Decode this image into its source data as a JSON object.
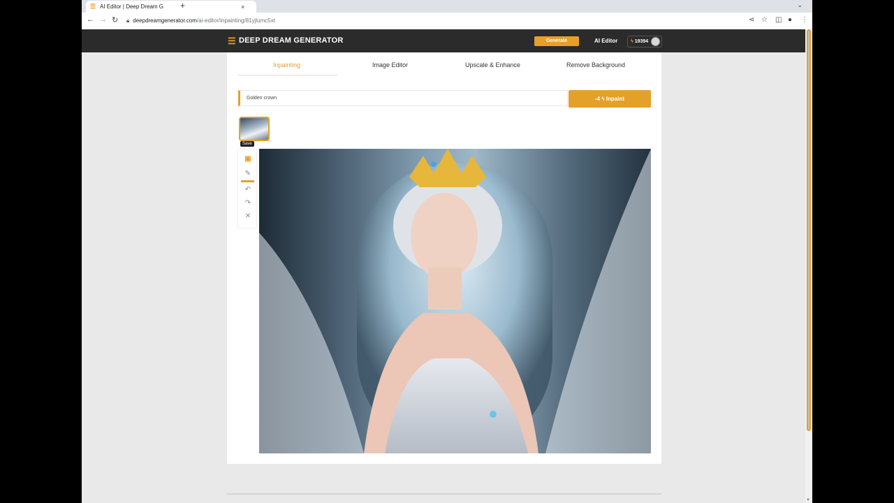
{
  "browser": {
    "tab_title": "AI Editor | Deep Dream G",
    "tab_close": "×",
    "new_tab": "+",
    "url_host": "deepdreamgenerator.com",
    "url_path": "/ai-editor/inpainting/81yjlumc5xt"
  },
  "header": {
    "logo_text": "DEEP DREAM GENERATOR",
    "generate_label": "Generate",
    "ai_editor_label": "AI Editor",
    "credits": "19394"
  },
  "editor": {
    "tabs": [
      {
        "label": "Inpainting"
      },
      {
        "label": "Image Editor"
      },
      {
        "label": "Upscale & Enhance"
      },
      {
        "label": "Remove Background"
      }
    ],
    "prompt_value": "Golden crown",
    "inpaint_button": "-4 ϟ  Inpaint",
    "tooltip": "Save"
  },
  "colors": {
    "accent": "#e5a02a",
    "header_bg": "#2b2b2b",
    "page_bg": "#e9e9e9"
  }
}
